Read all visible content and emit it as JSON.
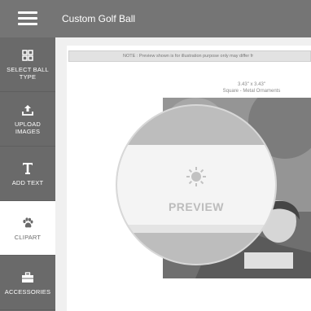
{
  "header": {
    "title": "Custom Golf Ball"
  },
  "sidebar": {
    "items": [
      {
        "label_line1": "SELECT BALL",
        "label_line2": "TYPE",
        "icon": "grid-icon"
      },
      {
        "label_line1": "UPLOAD",
        "label_line2": "IMAGES",
        "icon": "upload-icon"
      },
      {
        "label_line1": "ADD TEXT",
        "label_line2": "",
        "icon": "text-icon"
      },
      {
        "label_line1": "CLIPART",
        "label_line2": "",
        "icon": "paw-icon"
      },
      {
        "label_line1": "ACCESSORIES",
        "label_line2": "",
        "icon": "briefcase-icon"
      }
    ],
    "active_index": 3
  },
  "main": {
    "note": "NOTE : Preview shown is for illustration purpose only may differ fr",
    "size_line1": "3.43\" x 3.43\"",
    "size_line2": "Square - Metal Ornaments",
    "preview_label": "PREVIEW"
  },
  "colors": {
    "topbar": "#757575",
    "sidebar": "#6a6a6a",
    "active_item": "#ffffff"
  }
}
